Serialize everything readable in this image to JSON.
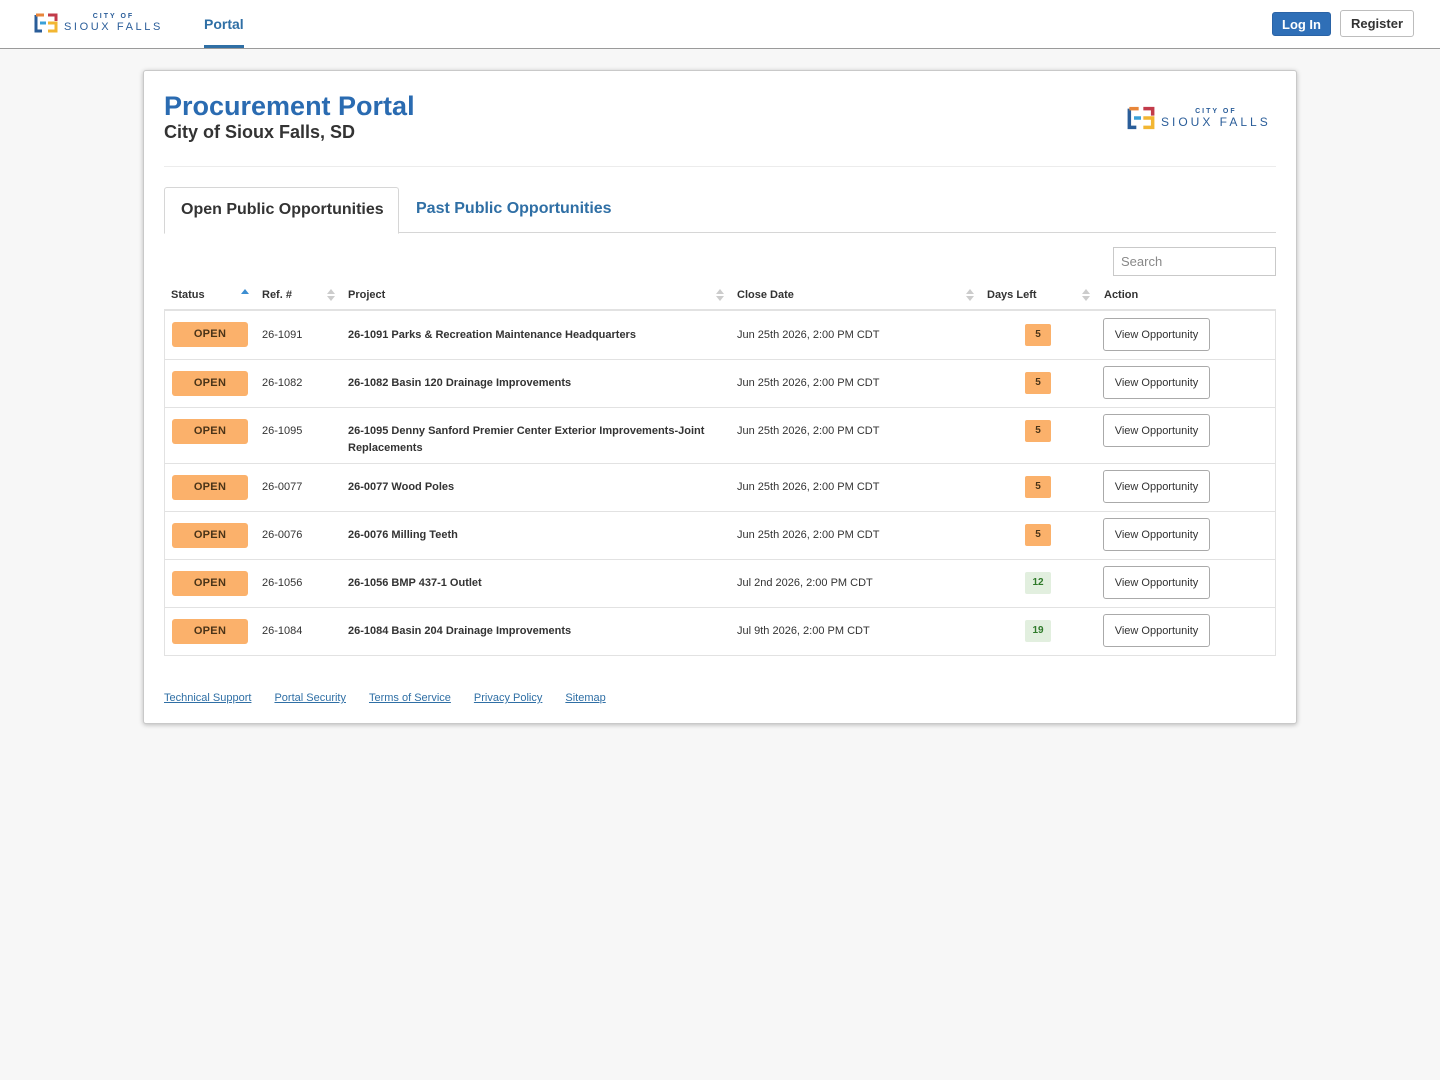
{
  "header": {
    "logo": {
      "small": "CITY OF",
      "big": "SIOUX FALLS"
    },
    "nav_portal": "Portal",
    "login_label": "Log In",
    "register_label": "Register"
  },
  "page": {
    "title": "Procurement Portal",
    "subtitle": "City of Sioux Falls, SD",
    "logo": {
      "small": "CITY OF",
      "big": "SIOUX FALLS"
    }
  },
  "tabs": [
    {
      "label": "Open Public Opportunities",
      "active": true
    },
    {
      "label": "Past Public Opportunities",
      "active": false
    }
  ],
  "search": {
    "placeholder": "Search",
    "value": ""
  },
  "table": {
    "columns": [
      "Status",
      "Ref. #",
      "Project",
      "Close Date",
      "Days Left",
      "Action"
    ],
    "sort": {
      "column": "Status",
      "direction": "ascending"
    },
    "rows": [
      {
        "status": "OPEN",
        "ref": "26-1091",
        "project": "26-1091 Parks & Recreation Maintenance Headquarters",
        "close_date": "Jun 25th 2026, 2:00 PM CDT",
        "days_left": "5",
        "days_level": "warn",
        "action": "View Opportunity"
      },
      {
        "status": "OPEN",
        "ref": "26-1082",
        "project": "26-1082 Basin 120 Drainage Improvements",
        "close_date": "Jun 25th 2026, 2:00 PM CDT",
        "days_left": "5",
        "days_level": "warn",
        "action": "View Opportunity"
      },
      {
        "status": "OPEN",
        "ref": "26-1095",
        "project": "26-1095 Denny Sanford Premier Center Exterior Improvements-Joint Replacements",
        "close_date": "Jun 25th 2026, 2:00 PM CDT",
        "days_left": "5",
        "days_level": "warn",
        "action": "View Opportunity"
      },
      {
        "status": "OPEN",
        "ref": "26-0077",
        "project": "26-0077 Wood Poles",
        "close_date": "Jun 25th 2026, 2:00 PM CDT",
        "days_left": "5",
        "days_level": "warn",
        "action": "View Opportunity"
      },
      {
        "status": "OPEN",
        "ref": "26-0076",
        "project": "26-0076 Milling Teeth",
        "close_date": "Jun 25th 2026, 2:00 PM CDT",
        "days_left": "5",
        "days_level": "warn",
        "action": "View Opportunity"
      },
      {
        "status": "OPEN",
        "ref": "26-1056",
        "project": "26-1056 BMP 437-1 Outlet",
        "close_date": "Jul 2nd 2026, 2:00 PM CDT",
        "days_left": "12",
        "days_level": "ok",
        "action": "View Opportunity"
      },
      {
        "status": "OPEN",
        "ref": "26-1084",
        "project": "26-1084 Basin 204 Drainage Improvements",
        "close_date": "Jul 9th 2026, 2:00 PM CDT",
        "days_left": "19",
        "days_level": "ok",
        "action": "View Opportunity"
      }
    ]
  },
  "footer": {
    "links": [
      "Technical Support",
      "Portal Security",
      "Terms of Service",
      "Privacy Policy",
      "Sitemap"
    ]
  },
  "colors": {
    "primary": "#2a6bb1",
    "status_open": "#fbb16b",
    "days_ok_bg": "#e2efdf",
    "days_ok_text": "#2f7a2a"
  }
}
